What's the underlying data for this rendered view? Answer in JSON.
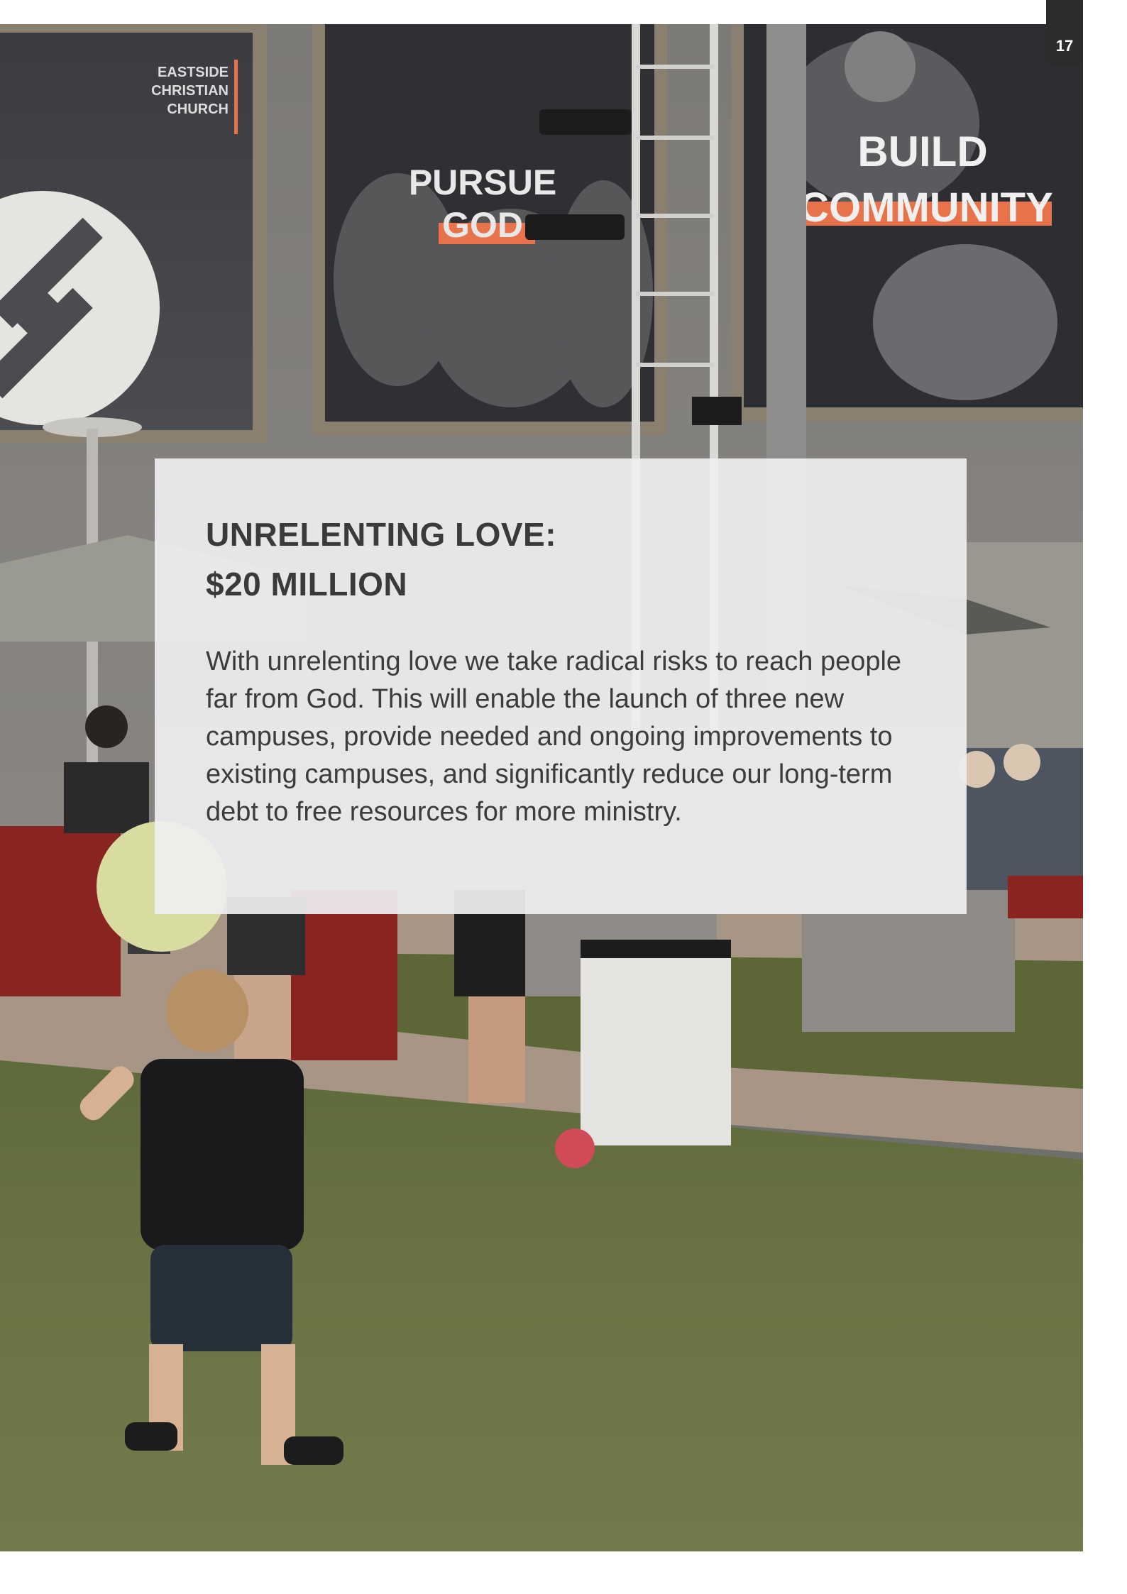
{
  "page": {
    "number": "17"
  },
  "photo": {
    "description_icon": "event-photo",
    "banners": {
      "left_label": "EASTSIDE\nCHRISTIAN\nCHURCH",
      "left_line1": "EASTSIDE",
      "left_line2": "CHRISTIAN",
      "left_line3": "CHURCH",
      "middle_line1": "PURSUE",
      "middle_line2": "GOD",
      "right_line1": "BUILD",
      "right_line2": "COMMUNITY"
    },
    "accent_color": "#e8734a"
  },
  "content": {
    "heading_line1": "UNRELENTING LOVE:",
    "heading_line2": "$20 MILLION",
    "body": "With unrelenting love we take radical risks to reach people far from God. This will enable the launch of three new campuses, provide needed and ongoing improvements to existing campuses, and significantly reduce our long-term debt to free resources for more ministry."
  }
}
